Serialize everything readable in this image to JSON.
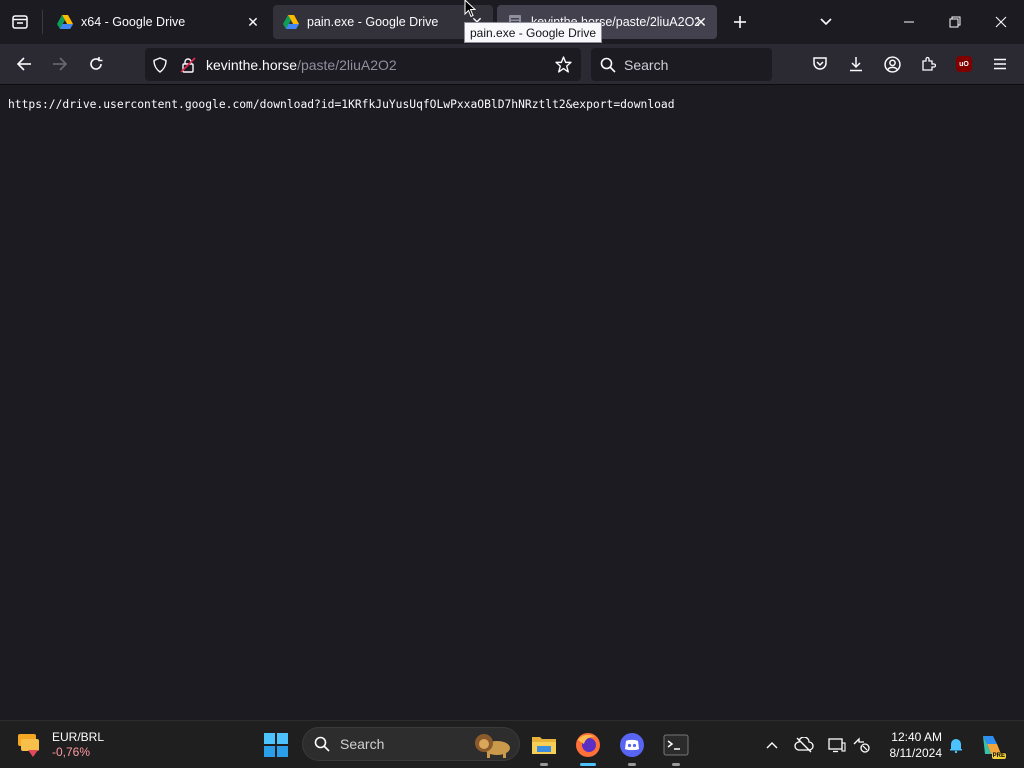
{
  "browser": {
    "tabs": [
      {
        "label": "x64 - Google Drive"
      },
      {
        "label": "pain.exe - Google Drive"
      },
      {
        "label": "kevinthe.horse/paste/2liuA2O2"
      }
    ],
    "tooltip": "pain.exe - Google Drive",
    "url": {
      "host": "kevinthe.horse",
      "path": "/paste/2liuA2O2"
    },
    "search_placeholder": "Search",
    "addon_badge": "uO"
  },
  "page": {
    "content": "https://drive.usercontent.google.com/download?id=1KRfkJuYusUqfOLwPxxaOBlD7hNRztlt2&export=download"
  },
  "taskbar": {
    "widget": {
      "label": "EUR/BRL",
      "value": "-0,76%",
      "value_color": "#ff99a4"
    },
    "search_placeholder": "Search",
    "clock": {
      "time": "12:40 AM",
      "date": "8/11/2024"
    },
    "copilot_badge": "PRE"
  },
  "colors": {
    "accent": "#4cc2ff",
    "browser_bg": "#1c1b22",
    "toolbar_bg": "#2b2a33"
  }
}
